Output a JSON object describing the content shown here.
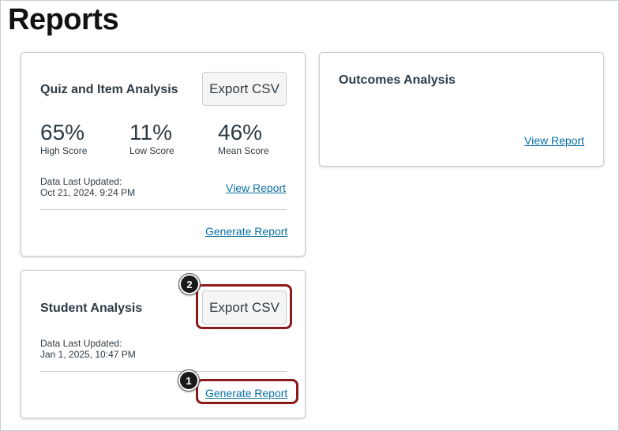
{
  "page": {
    "title": "Reports"
  },
  "quiz_card": {
    "title": "Quiz and Item Analysis",
    "export_label": "Export CSV",
    "stats": [
      {
        "value": "65%",
        "label": "High Score"
      },
      {
        "value": "11%",
        "label": "Low Score"
      },
      {
        "value": "46%",
        "label": "Mean Score"
      }
    ],
    "updated_label": "Data Last Updated:",
    "updated_value": "Oct 21, 2024, 9:24 PM",
    "view_report_label": "View Report",
    "generate_report_label": "Generate Report"
  },
  "outcomes_card": {
    "title": "Outcomes Analysis",
    "view_report_label": "View Report"
  },
  "student_card": {
    "title": "Student Analysis",
    "export_label": "Export CSV",
    "updated_label": "Data Last Updated:",
    "updated_value": "Jan 1, 2025, 10:47 PM",
    "generate_report_label": "Generate Report"
  },
  "callouts": [
    {
      "number": "1"
    },
    {
      "number": "2"
    }
  ],
  "colors": {
    "link": "#0770a3",
    "highlight": "#8b1a1a",
    "badge": "#1a1a1a"
  }
}
